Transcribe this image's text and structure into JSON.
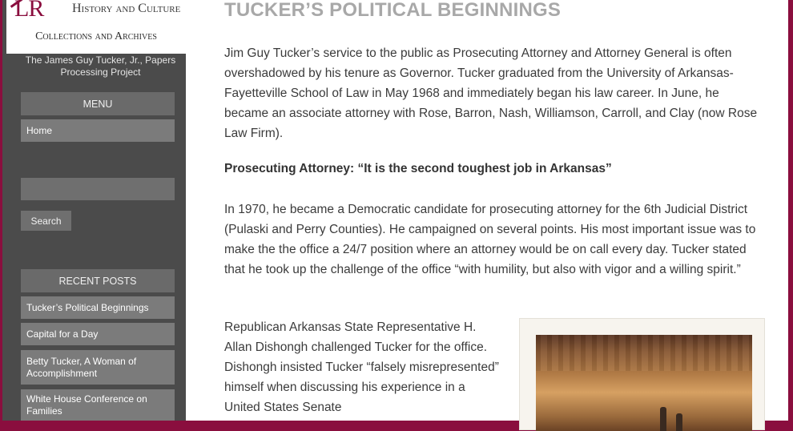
{
  "logo": {
    "monogram": "LR",
    "title": "History and Culture",
    "subtitle": "Collections and Archives"
  },
  "sidebar": {
    "project_title": "The James Guy Tucker, Jr., Papers Processing Project",
    "menu_title": "MENU",
    "menu_items": [
      "Home"
    ],
    "search": {
      "value": "",
      "placeholder": "",
      "button_label": "Search"
    },
    "recent_posts_title": "RECENT POSTS",
    "recent_posts": [
      "Tucker’s Political Beginnings",
      "Capital for a Day",
      "Betty Tucker, A Woman of Accomplishment",
      "White House Conference on Families"
    ]
  },
  "post": {
    "title": "TUCKER’S POLITICAL BEGINNINGS",
    "paragraphs": [
      "Jim Guy Tucker’s service to the public as Prosecuting Attorney and Attorney General is often overshadowed by his tenure as Governor. Tucker graduated from the University of Arkansas-Fayetteville School of Law in May 1968 and immediately began his law career. In June, he became an associate attorney with Rose, Barron, Nash, Williamson, Carroll, and Clay (now Rose Law Firm).",
      "In 1970, he became a Democratic candidate for prosecuting attorney for the 6th Judicial District (Pulaski and Perry Counties). He campaigned on several points. His most important issue was to make the the office a 24/7 position where an attorney would be on call every day. Tucker stated that he took up the challenge of the office “with humility, but also with vigor and a willing spirit.”",
      "Republican Arkansas State Representative H. Allan Dishongh challenged Tucker for the office. Dishongh insisted Tucker “falsely misrepresented” himself when discussing his experience in a United States Senate"
    ],
    "heading": "Prosecuting Attorney: “It is the second toughest job in Arkansas”"
  },
  "colors": {
    "brand_maroon": "#8a0e3e",
    "sidebar_bg": "#4b4b4b",
    "widget_bg": "#6a6a6a",
    "nav_item_bg": "#7b7b7b",
    "title_gray": "#a8a8a8"
  }
}
